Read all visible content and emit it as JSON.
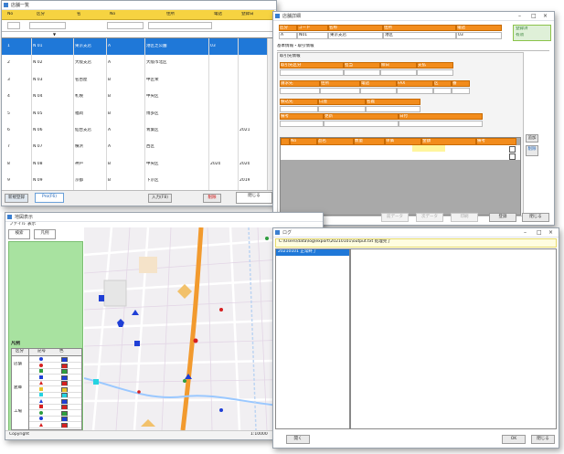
{
  "list_window": {
    "title": "店舗一覧",
    "columns": [
      "No",
      "区分",
      "名",
      "No",
      "住所",
      "電話",
      "登録日"
    ],
    "filter": {
      "sort_indicator": "▼"
    },
    "rows": [
      {
        "no": "1",
        "code": "N 01",
        "name": "東京支店",
        "type": "A",
        "addr": "港区芝公園",
        "tel": "03",
        "date": "",
        "selected": true
      },
      {
        "no": "2",
        "code": "N 02",
        "name": "大阪支店",
        "type": "A",
        "addr": "大阪市北区",
        "tel": "",
        "date": ""
      },
      {
        "no": "3",
        "code": "N 03",
        "name": "名古屋",
        "type": "B",
        "addr": "中区栄",
        "tel": "",
        "date": ""
      },
      {
        "no": "4",
        "code": "N 04",
        "name": "札幌",
        "type": "B",
        "addr": "中央区",
        "tel": "",
        "date": ""
      },
      {
        "no": "5",
        "code": "N 05",
        "name": "福岡",
        "type": "B",
        "addr": "博多区",
        "tel": "",
        "date": ""
      },
      {
        "no": "6",
        "code": "N 06",
        "name": "仙台支店",
        "type": "A",
        "addr": "青葉区",
        "tel": "",
        "date": "2021"
      },
      {
        "no": "7",
        "code": "N 07",
        "name": "横浜",
        "type": "A",
        "addr": "西区",
        "tel": "",
        "date": ""
      },
      {
        "no": "8",
        "code": "N 08",
        "name": "神戸",
        "type": "B",
        "addr": "中央区",
        "tel": "2020",
        "date": "2020"
      },
      {
        "no": "9",
        "code": "N 09",
        "name": "京都",
        "type": "B",
        "addr": "下京区",
        "tel": "",
        "date": "2019"
      }
    ],
    "footer": {
      "left_btn": "新規登録",
      "active_tab": "Pro(F6)",
      "mid": "入力(F8)",
      "delete": "削除",
      "right": "閉じる"
    }
  },
  "detail_window": {
    "title": "店舗詳細",
    "top_headers": [
      "区分",
      "コード",
      "名称",
      "住所",
      "電話"
    ],
    "top_values": [
      "A",
      "N01",
      "東京支店",
      "港区",
      "03"
    ],
    "status": {
      "label": "登録済",
      "value": "有効"
    },
    "section_title": "基本情報・取引情報",
    "panel_label": "取引先情報",
    "row1_headers": [
      "取引先区分",
      "担当",
      "締日",
      "支払"
    ],
    "row2_headers": [
      "請求先",
      "住所",
      "電話",
      "FAX",
      "区",
      "番"
    ],
    "row3_headers": [
      "振込先",
      "口座",
      "名義"
    ],
    "row4_headers": [
      "備考",
      "更新",
      "日付"
    ],
    "grid_headers": [
      "No",
      "品名",
      "数量",
      "単価",
      "金額",
      "備考"
    ],
    "side_buttons": [
      "追加",
      "削除"
    ],
    "buttons": [
      {
        "label": "前データ",
        "enabled": false
      },
      {
        "label": "次データ",
        "enabled": false
      },
      {
        "label": "印刷",
        "enabled": false
      },
      {
        "label": "登録",
        "enabled": true
      },
      {
        "label": "閉じる",
        "enabled": true
      }
    ]
  },
  "map_window": {
    "title": "地図表示",
    "menu": [
      "ファイル",
      "表示"
    ],
    "toolbar": [
      "検索",
      "凡例"
    ],
    "legend": {
      "title": "凡例",
      "headers": [
        "区分",
        "記号",
        "色"
      ],
      "groups": [
        "店舗",
        "倉庫",
        "工場"
      ],
      "colors": {
        "blue": "#1f3fd6",
        "red": "#d62020",
        "green": "#2f9e3f",
        "yellow": "#e8c22a",
        "cyan": "#25d3e0"
      }
    },
    "status_left": "Copyright",
    "status_right": "1:10000"
  },
  "log_window": {
    "title": "ログ",
    "path_text": "C:\\Users\\data\\log\\export\\20210101\\output.txt 処理完了",
    "list_item": "20210101 正常終了",
    "buttons": {
      "left": "開く",
      "ok": "OK",
      "cancel": "閉じる"
    }
  }
}
